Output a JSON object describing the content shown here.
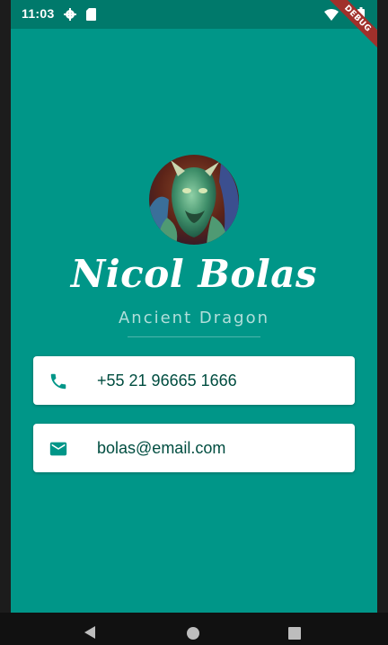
{
  "status_bar": {
    "time": "11:03",
    "icons": [
      "gear-icon",
      "sd-card-icon",
      "wifi-icon",
      "battery-icon"
    ]
  },
  "debug_banner": "DEBUG",
  "profile": {
    "name": "Nicol Bolas",
    "title": "Ancient Dragon"
  },
  "contacts": {
    "phone": {
      "icon": "phone-icon",
      "value": "+55 21 96665 1666"
    },
    "email": {
      "icon": "email-icon",
      "value": "bolas@email.com"
    }
  },
  "nav_bar": {
    "buttons": [
      "back-icon",
      "home-icon",
      "recents-icon"
    ]
  },
  "colors": {
    "background": "#009688",
    "status_bar": "#00796b",
    "card": "#ffffff",
    "card_text": "#004d40",
    "subtitle": "#b2dfdb",
    "icon": "#009688"
  }
}
